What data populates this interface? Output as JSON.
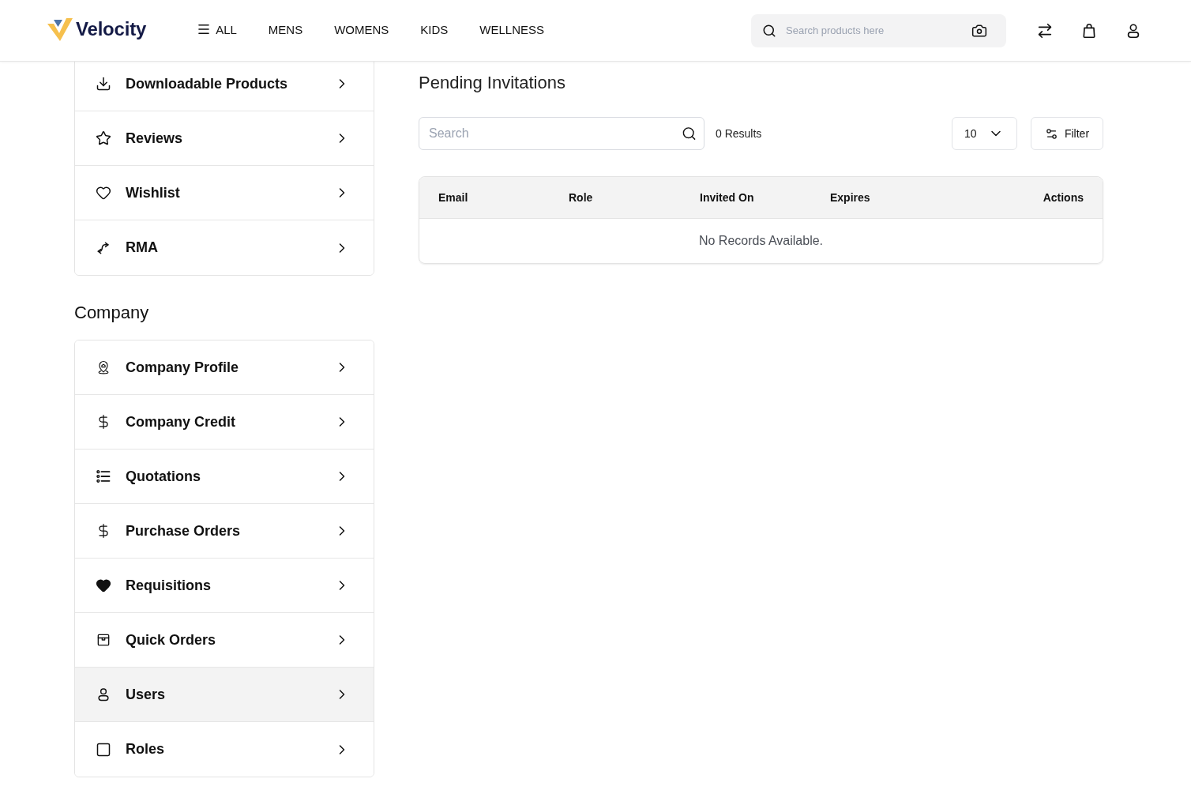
{
  "header": {
    "logo": {
      "name": "Velocity"
    },
    "nav": [
      {
        "label": "ALL",
        "kind": "menu"
      },
      {
        "label": "MENS",
        "kind": "link"
      },
      {
        "label": "WOMENS",
        "kind": "link"
      },
      {
        "label": "KIDS",
        "kind": "link"
      },
      {
        "label": "WELLNESS",
        "kind": "link"
      }
    ],
    "search": {
      "placeholder": "Search products here"
    }
  },
  "sidebar": {
    "groups": [
      {
        "items": [
          {
            "label": "Downloadable Products",
            "kind": "download",
            "selected": false
          },
          {
            "label": "Reviews",
            "kind": "review",
            "selected": false
          },
          {
            "label": "Wishlist",
            "kind": "wishlist",
            "selected": false
          },
          {
            "label": "RMA",
            "kind": "return",
            "selected": false
          }
        ]
      },
      {
        "title": "Company",
        "items": [
          {
            "label": "Company Profile",
            "kind": "profile",
            "selected": false
          },
          {
            "label": "Company Credit",
            "kind": "credit",
            "selected": false
          },
          {
            "label": "Quotations",
            "kind": "quote",
            "selected": false
          },
          {
            "label": "Purchase Orders",
            "kind": "purchase",
            "selected": false
          },
          {
            "label": "Requisitions",
            "kind": "requisition",
            "selected": false
          },
          {
            "label": "Quick Orders",
            "kind": "quickorder",
            "selected": false
          },
          {
            "label": "Users",
            "kind": "user",
            "selected": true
          },
          {
            "label": "Roles",
            "kind": "role",
            "selected": false
          }
        ]
      }
    ]
  },
  "main": {
    "title": "Pending Invitations",
    "search": {
      "placeholder": "Search"
    },
    "result_count": "0 Results",
    "page_size": {
      "value": "10"
    },
    "filter_button": {
      "label": "Filter"
    },
    "table": {
      "columns": [
        "Email",
        "Role",
        "Invited On",
        "Expires",
        "Actions"
      ],
      "empty_message": "No Records Available."
    }
  }
}
